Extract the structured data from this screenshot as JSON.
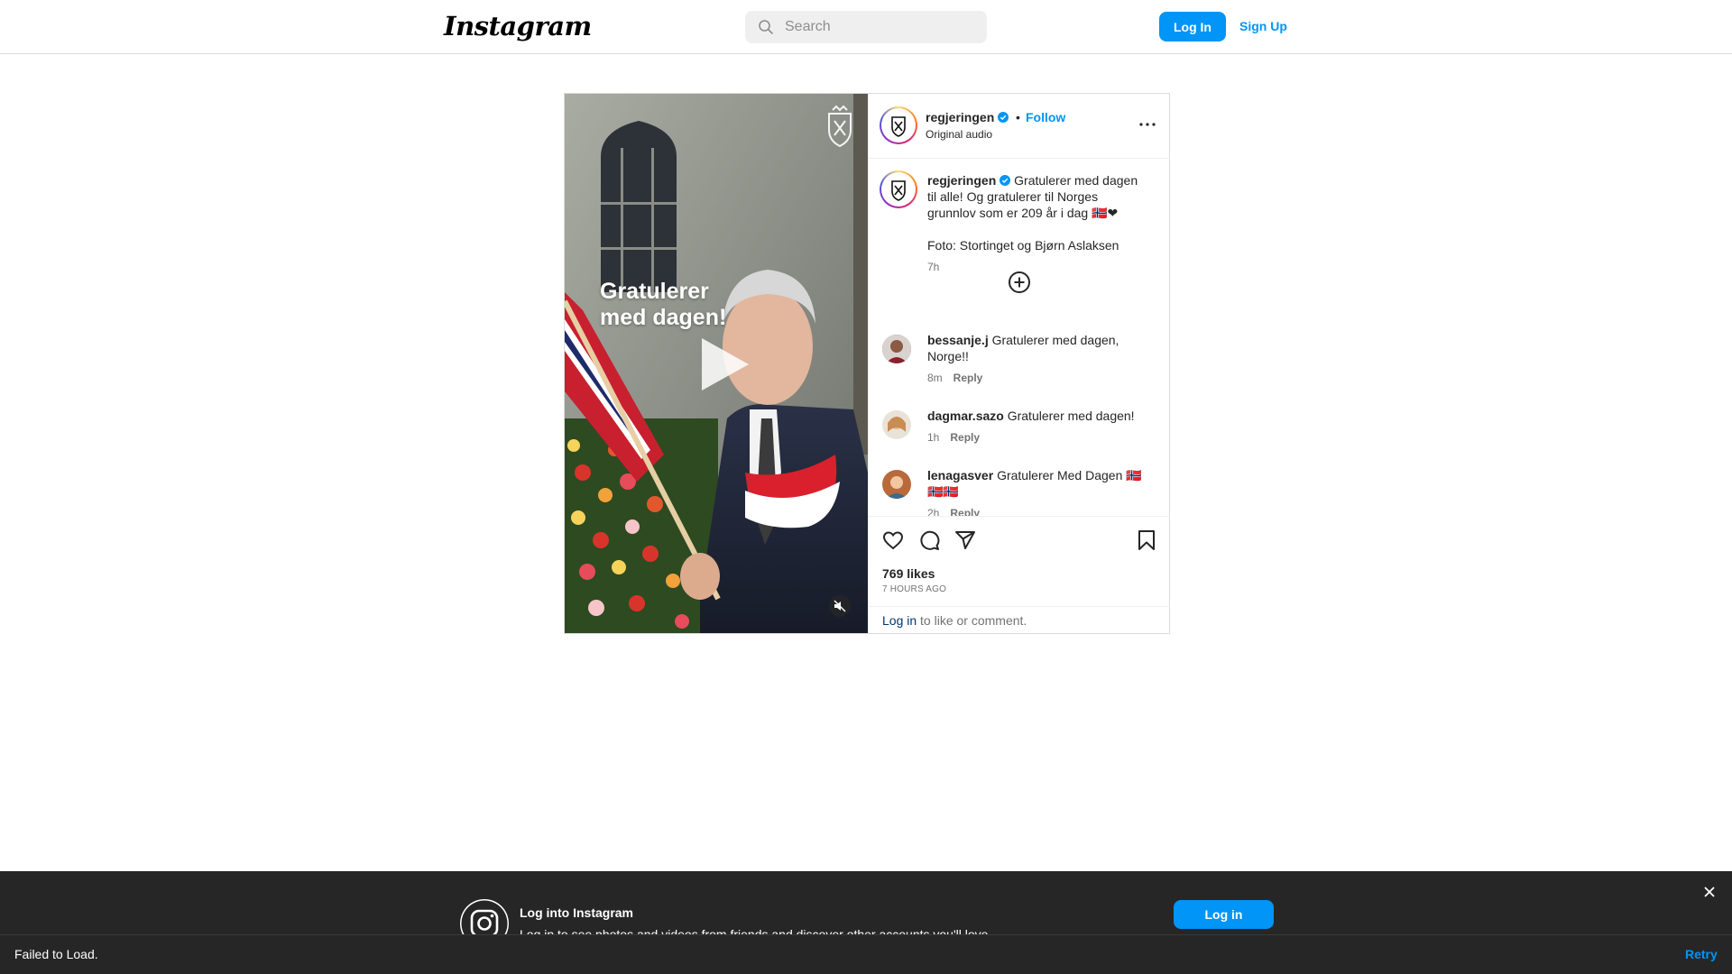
{
  "header": {
    "logo": "Instagram",
    "search_placeholder": "Search",
    "login_label": "Log In",
    "signup_label": "Sign Up"
  },
  "post": {
    "overlay_text_line1": "Gratulerer",
    "overlay_text_line2": "med dagen!",
    "author": {
      "username": "regjeringen",
      "verified": true,
      "follow_label": "Follow",
      "separator": "•",
      "audio": "Original audio"
    },
    "caption": {
      "username": "regjeringen",
      "text_line1": "Gratulerer med dagen til alle! Og gratulerer til Norges grunnlov som er 209 år i dag 🇳🇴❤",
      "text_line2": "Foto: Stortinget og Bjørn Aslaksen",
      "time": "7h"
    },
    "comments": [
      {
        "username": "bessanje.j",
        "text": "Gratulerer med dagen, Norge!!",
        "time": "8m",
        "reply": "Reply"
      },
      {
        "username": "dagmar.sazo",
        "text": "Gratulerer med dagen!",
        "time": "1h",
        "reply": "Reply"
      },
      {
        "username": "lenagasver",
        "text": "Gratulerer Med Dagen 🇳🇴🇳🇴🇳🇴",
        "time": "2h",
        "reply": "Reply"
      }
    ],
    "likes": "769 likes",
    "posted_ago": "7 HOURS AGO",
    "login_prompt_link": "Log in",
    "login_prompt_rest": " to like or comment."
  },
  "banner": {
    "title": "Log into Instagram",
    "subtitle": "Log in to see photos and videos from friends and discover other accounts you'll love.",
    "login_label": "Log in"
  },
  "toast": {
    "message": "Failed to Load.",
    "retry_label": "Retry"
  },
  "colors": {
    "accent": "#0095f6",
    "dark_banner": "#262626",
    "border": "#dbdbdb"
  }
}
